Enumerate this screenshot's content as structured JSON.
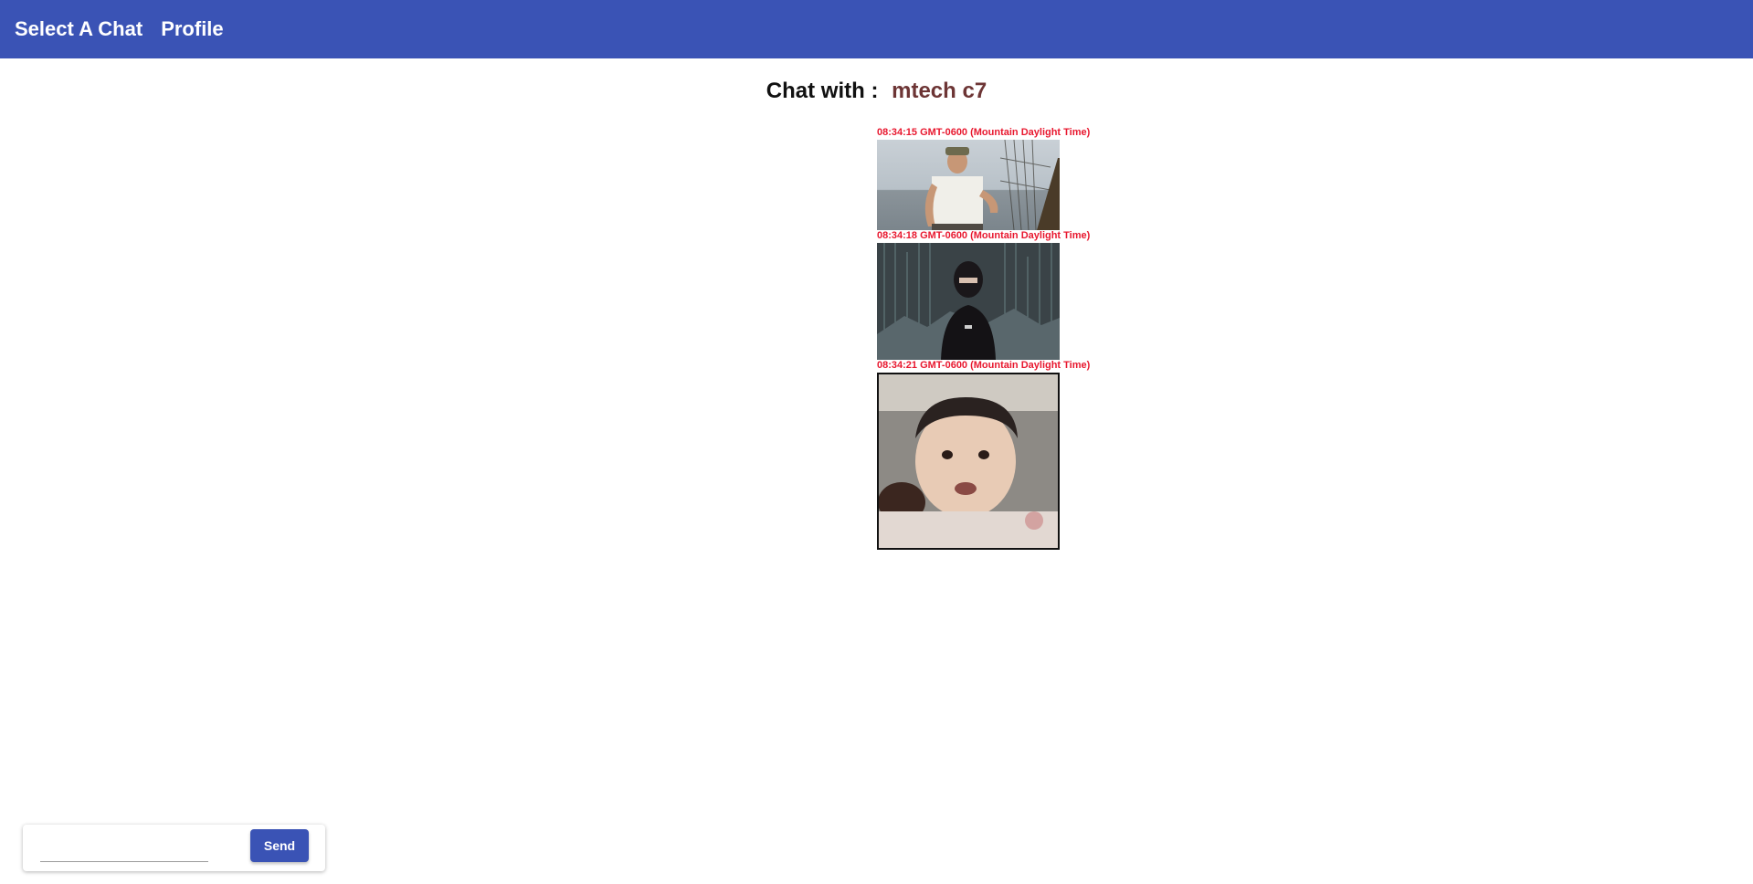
{
  "nav": {
    "select_chat": "Select A Chat",
    "profile": "Profile"
  },
  "chat": {
    "label": "Chat with :",
    "partner": "mtech c7"
  },
  "messages": [
    {
      "timestamp": "08:34:15 GMT-0600 (Mountain Daylight Time)"
    },
    {
      "timestamp": "08:34:18 GMT-0600 (Mountain Daylight Time)"
    },
    {
      "timestamp": "08:34:21 GMT-0600 (Mountain Daylight Time)"
    }
  ],
  "composer": {
    "placeholder": "",
    "send_label": "Send"
  },
  "colors": {
    "primary": "#3a53b5",
    "timestamp": "#e8182f",
    "partner_name": "#6d3535"
  }
}
